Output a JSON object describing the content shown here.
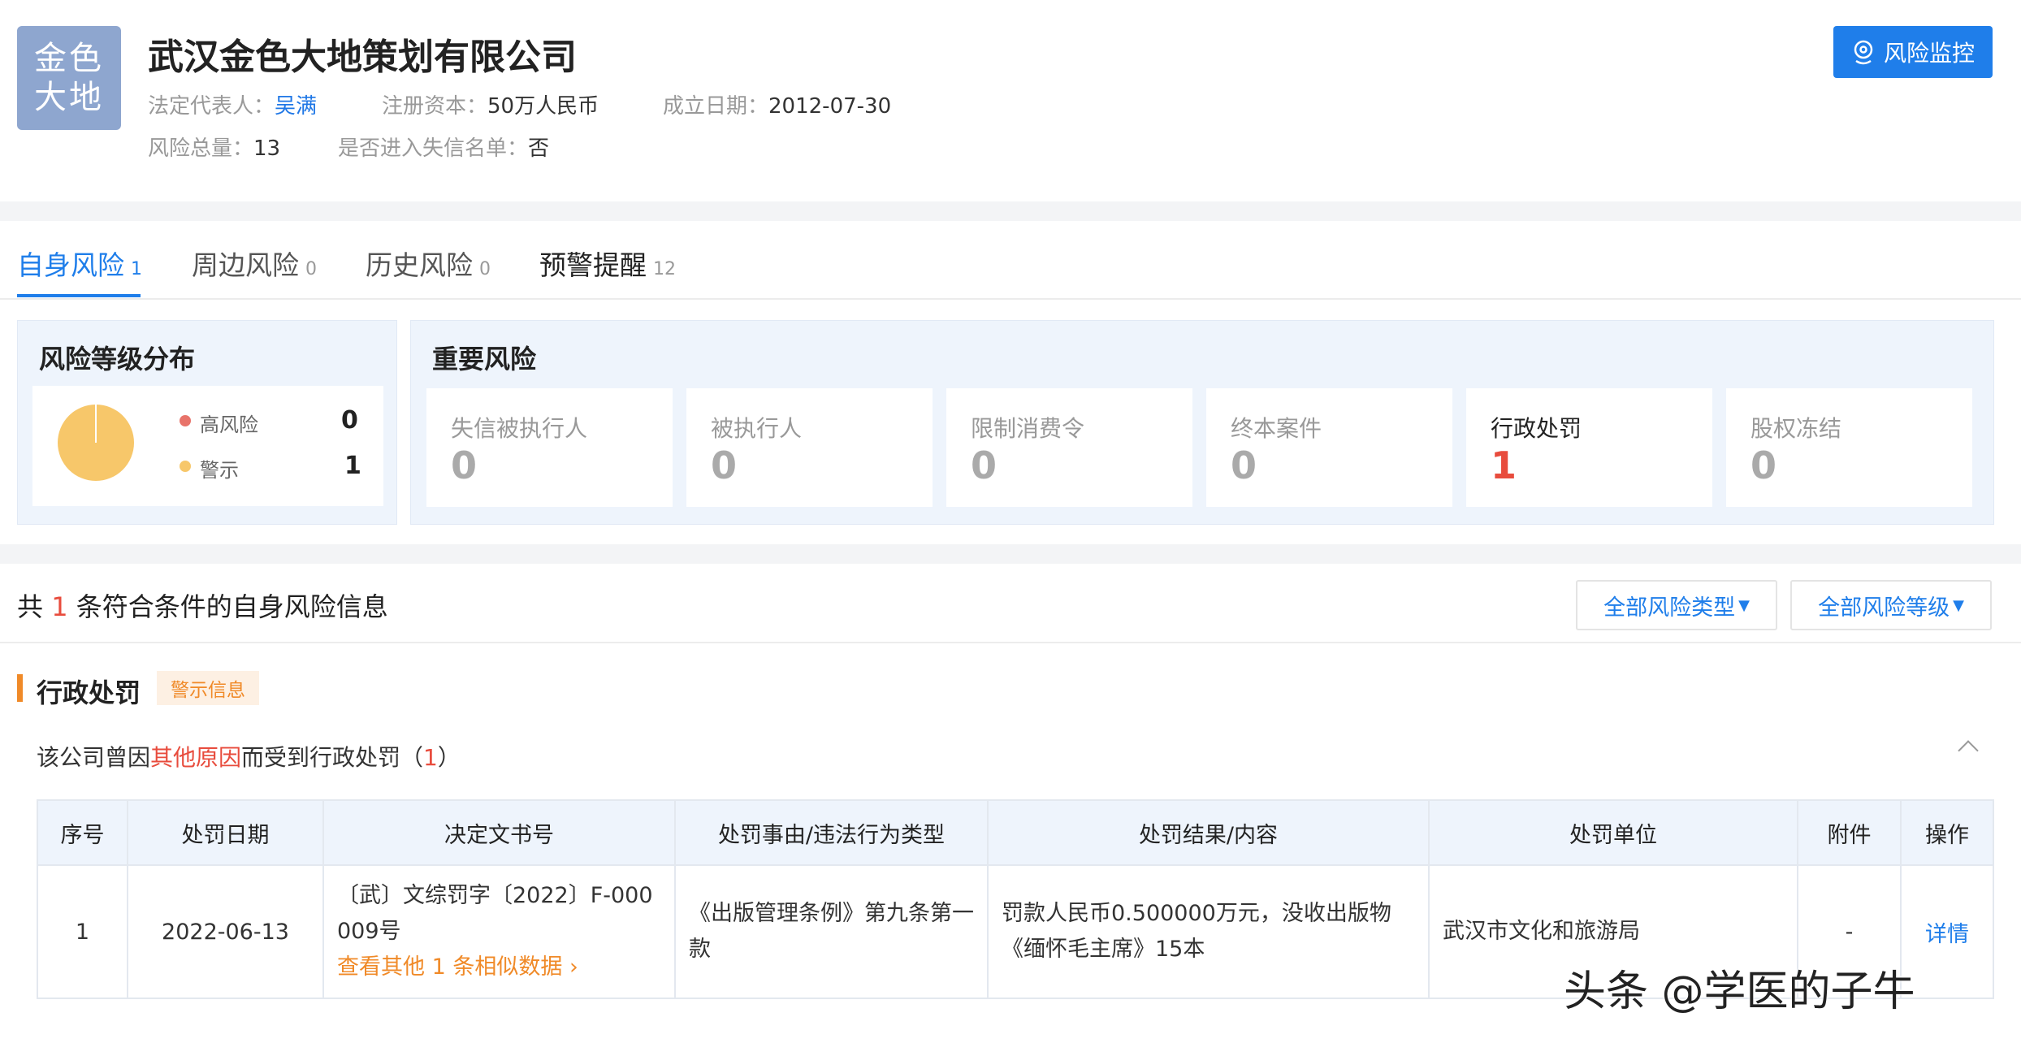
{
  "company": {
    "logo_line1": "金色",
    "logo_line2": "大地",
    "name": "武汉金色大地策划有限公司",
    "legal_rep_label": "法定代表人：",
    "legal_rep": "吴满",
    "capital_label": "注册资本：",
    "capital": "50万人民币",
    "founded_label": "成立日期：",
    "founded": "2012-07-30",
    "risk_total_label": "风险总量：",
    "risk_total": "13",
    "dishonest_label": "是否进入失信名单：",
    "dishonest": "否"
  },
  "header": {
    "monitor_button": "风险监控"
  },
  "tabs": [
    {
      "label": "自身风险",
      "count": "1"
    },
    {
      "label": "周边风险",
      "count": "0"
    },
    {
      "label": "历史风险",
      "count": "0"
    },
    {
      "label": "预警提醒",
      "count": "12"
    }
  ],
  "distribution": {
    "title": "风险等级分布",
    "items": [
      {
        "label": "高风险",
        "value": "0",
        "color": "#e8736a"
      },
      {
        "label": "警示",
        "value": "1",
        "color": "#f7c76a"
      }
    ],
    "pie_color": "#f7c76a"
  },
  "important": {
    "title": "重要风险",
    "cards": [
      {
        "label": "失信被执行人",
        "value": "0"
      },
      {
        "label": "被执行人",
        "value": "0"
      },
      {
        "label": "限制消费令",
        "value": "0"
      },
      {
        "label": "终本案件",
        "value": "0"
      },
      {
        "label": "行政处罚",
        "value": "1"
      },
      {
        "label": "股权冻结",
        "value": "0"
      }
    ]
  },
  "results": {
    "prefix": "共",
    "count": "1",
    "suffix": "条符合条件的自身风险信息",
    "filter_type": "全部风险类型",
    "filter_level": "全部风险等级"
  },
  "section": {
    "title": "行政处罚",
    "tag": "警示信息",
    "reason_prefix": "该公司曾因",
    "reason_highlight": "其他原因",
    "reason_suffix": "而受到行政处罚（",
    "reason_count": "1",
    "reason_end": "）"
  },
  "table": {
    "headers": [
      "序号",
      "处罚日期",
      "决定文书号",
      "处罚事由/违法行为类型",
      "处罚结果/内容",
      "处罚单位",
      "附件",
      "操作"
    ],
    "rows": [
      {
        "index": "1",
        "date": "2022-06-13",
        "doc_no": "〔武〕文综罚字〔2022〕F-000009号",
        "similar_link": "查看其他 1 条相似数据",
        "reason": "《出版管理条例》第九条第一款",
        "result": "罚款人民币0.500000万元，没收出版物《缅怀毛主席》15本",
        "unit": "武汉市文化和旅游局",
        "attachment": "-",
        "action": "详情"
      }
    ]
  },
  "watermark": "头条 @学医的子牛"
}
